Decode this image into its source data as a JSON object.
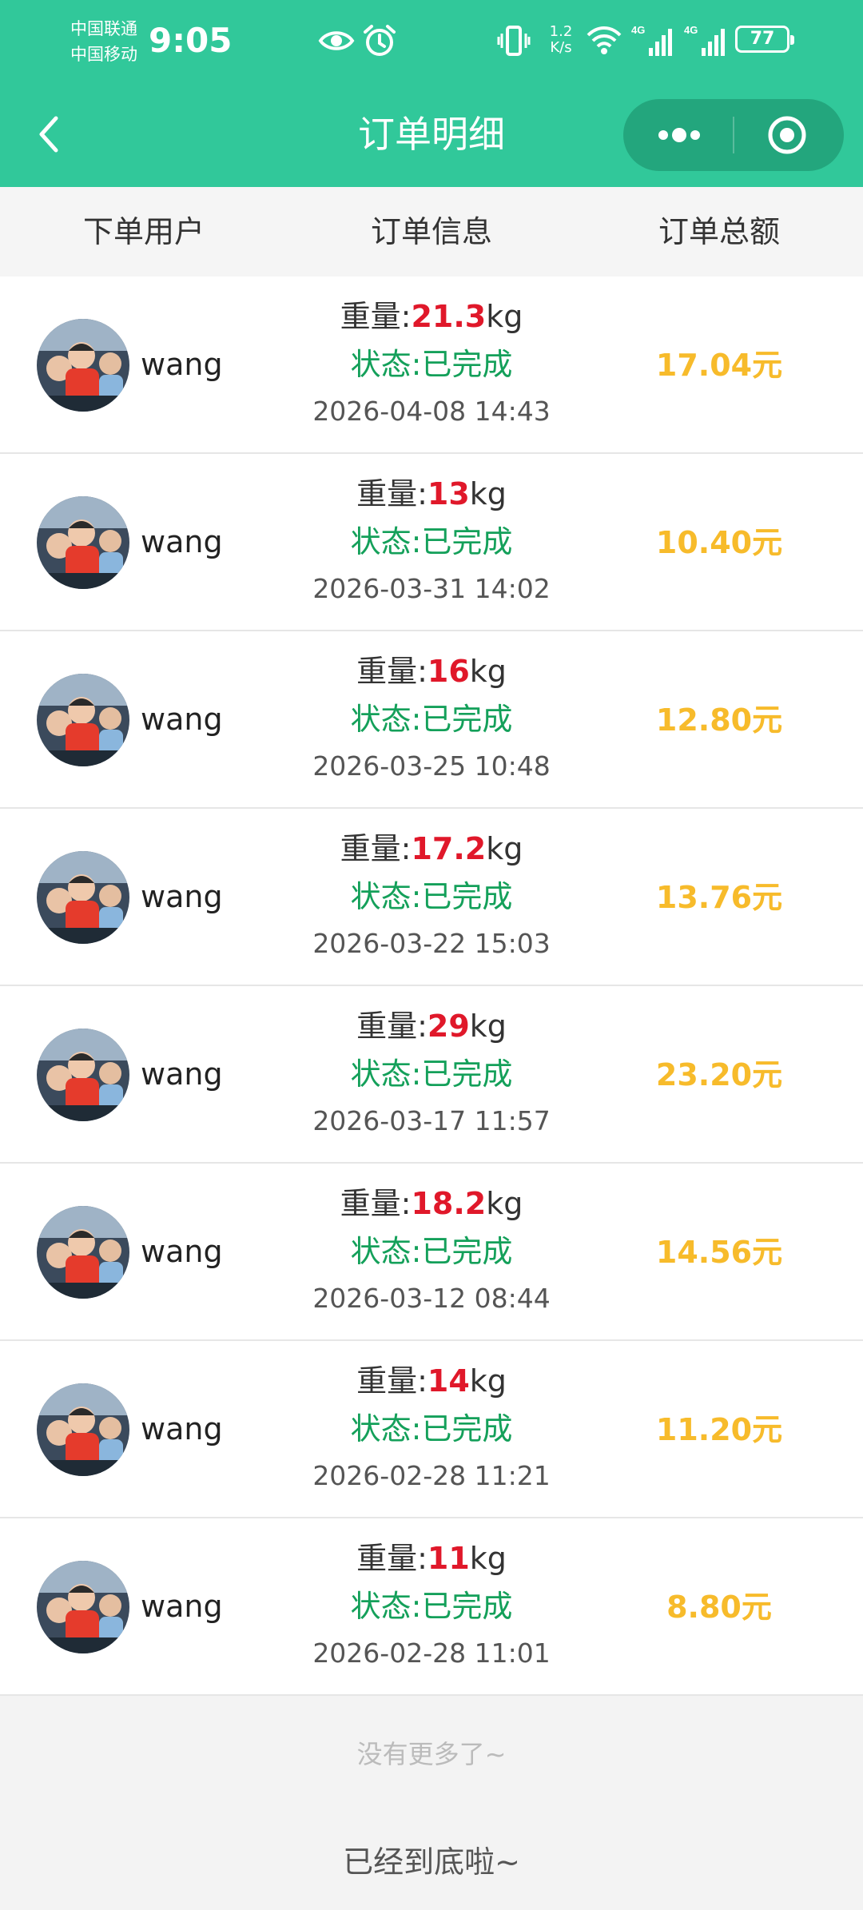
{
  "status_bar": {
    "carrier1": "中国联通",
    "carrier2": "中国移动",
    "time": "9:05",
    "speed_value": "1.2",
    "speed_unit": "K/s",
    "sig1_label": "4G",
    "sig2_label": "4G",
    "battery": "77"
  },
  "nav": {
    "title": "订单明细",
    "back_icon": "chevron-left-icon",
    "menu_icon": "more-dots-icon",
    "close_icon": "target-icon"
  },
  "colors": {
    "topbar": "#31c89a",
    "weight_value": "#e0182a",
    "status": "#14a05a",
    "amount": "#f7bb2b"
  },
  "header": {
    "col1": "下单用户",
    "col2": "订单信息",
    "col3": "订单总额"
  },
  "orders": [
    {
      "user": "wang",
      "weight_label": "重量:",
      "weight": "21.3",
      "unit": "kg",
      "status": "状态:已完成",
      "date": "2026-04-08 14:43",
      "amount": "17.04元"
    },
    {
      "user": "wang",
      "weight_label": "重量:",
      "weight": "13",
      "unit": "kg",
      "status": "状态:已完成",
      "date": "2026-03-31 14:02",
      "amount": "10.40元"
    },
    {
      "user": "wang",
      "weight_label": "重量:",
      "weight": "16",
      "unit": "kg",
      "status": "状态:已完成",
      "date": "2026-03-25 10:48",
      "amount": "12.80元"
    },
    {
      "user": "wang",
      "weight_label": "重量:",
      "weight": "17.2",
      "unit": "kg",
      "status": "状态:已完成",
      "date": "2026-03-22 15:03",
      "amount": "13.76元"
    },
    {
      "user": "wang",
      "weight_label": "重量:",
      "weight": "29",
      "unit": "kg",
      "status": "状态:已完成",
      "date": "2026-03-17 11:57",
      "amount": "23.20元"
    },
    {
      "user": "wang",
      "weight_label": "重量:",
      "weight": "18.2",
      "unit": "kg",
      "status": "状态:已完成",
      "date": "2026-03-12 08:44",
      "amount": "14.56元"
    },
    {
      "user": "wang",
      "weight_label": "重量:",
      "weight": "14",
      "unit": "kg",
      "status": "状态:已完成",
      "date": "2026-02-28 11:21",
      "amount": "11.20元"
    },
    {
      "user": "wang",
      "weight_label": "重量:",
      "weight": "11",
      "unit": "kg",
      "status": "状态:已完成",
      "date": "2026-02-28 11:01",
      "amount": "8.80元"
    }
  ],
  "footer": {
    "no_more": "没有更多了~",
    "bottom": "已经到底啦~"
  }
}
